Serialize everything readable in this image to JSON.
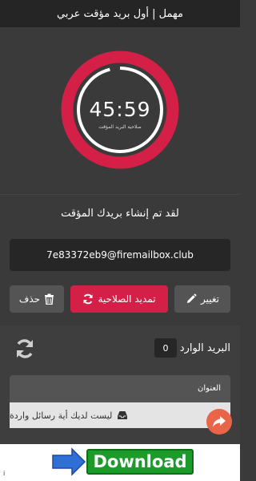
{
  "header": {
    "title": "مهمل | أول بريد مؤقت عربي"
  },
  "timer": {
    "time": "45:59",
    "label": "صلاحية البريد المؤقت",
    "remaining_fraction": 0.96
  },
  "main": {
    "created_message": "لقد تم إنشاء بريدك المؤقت",
    "email": "7e83372eb9@firemailbox.club"
  },
  "actions": {
    "change_label": "تغيير",
    "extend_label": "تمديد الصلاحية",
    "delete_label": "حذف"
  },
  "inbox": {
    "label": "البريد الوارد",
    "count": "0",
    "column_header": "العنوان",
    "empty_message": "ليست لديك أية رسائل واردة"
  },
  "ad": {
    "button_label": "Download",
    "info_symbol": "i"
  },
  "colors": {
    "accent": "#d41f47",
    "background": "#3a3a3a",
    "share": "#e8654a"
  }
}
